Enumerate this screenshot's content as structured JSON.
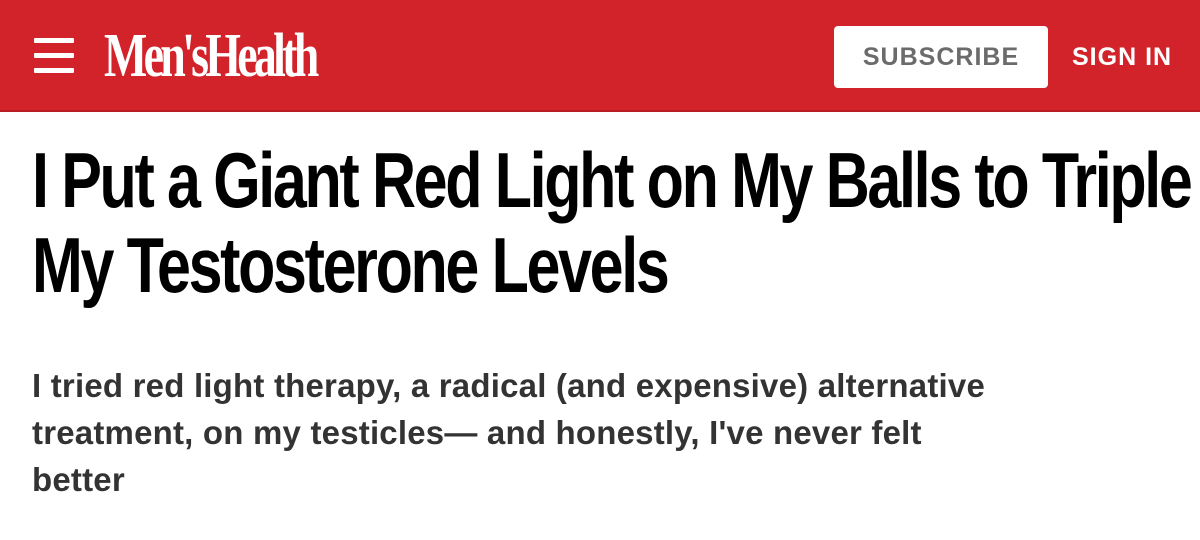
{
  "header": {
    "background_color": "#d2232a",
    "menu_icon": "hamburger-menu-icon",
    "logo_text": "Men'sHealth",
    "subscribe_label": "SUBSCRIBE",
    "signin_label": "SIGN IN"
  },
  "article": {
    "headline_lines": [
      "I Put a Giant Red Light on My Balls to Triple",
      "My Testosterone Levels"
    ],
    "dek_lines": [
      "I tried red light therapy, a radical (and expensive) alternative",
      "treatment, on my testicles— and honestly, I've never felt",
      "better"
    ]
  }
}
